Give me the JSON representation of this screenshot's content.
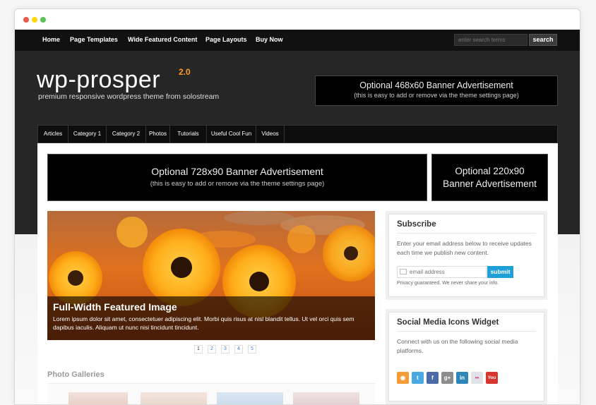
{
  "window_controls": {
    "close_color": "#ed594a",
    "minimize_color": "#fdd800",
    "zoom_color": "#5ac05a"
  },
  "top_nav": {
    "items": [
      "Home",
      "Page Templates",
      "Wide Featured Content",
      "Page Layouts",
      "Buy Now"
    ],
    "search_placeholder": "enter search terms",
    "search_button": "search"
  },
  "header": {
    "logo": "wp-prosper",
    "version": "2.0",
    "tagline": "premium responsive wordpress theme from solostream",
    "banner_468": {
      "line1": "Optional 468x60 Banner Advertisement",
      "line2": "(this is easy to add or remove via the theme settings page)"
    }
  },
  "category_nav": {
    "items": [
      "Articles",
      "Category 1",
      "Category 2",
      "Photos",
      "Tutorials",
      "Useful Cool Fun",
      "Videos"
    ]
  },
  "banners": {
    "banner_728": {
      "line1": "Optional 728x90 Banner Advertisement",
      "line2": "(this is easy to add or remove via the theme settings page)"
    },
    "banner_220": {
      "line1": "Optional 220x90",
      "line2": "Banner Advertisement"
    }
  },
  "featured": {
    "title": "Full-Width Featured Image",
    "text": "Lorem ipsum dolor sit amet, consectetuer adipiscing elit. Morbi quis risus at nisl blandit tellus. Ut vel orci quis sem dapibus iaculis. Aliquam ut nunc nisi tincidunt tincidunt.",
    "pages": [
      "1",
      "2",
      "3",
      "4",
      "5"
    ]
  },
  "photo_galleries": {
    "title": "Photo Galleries"
  },
  "subscribe": {
    "title": "Subscribe",
    "text": "Enter your email address below to receive updates each time we publish new content.",
    "email_placeholder": "email address",
    "submit": "submit",
    "privacy": "Privacy guaranteed. We never share your info."
  },
  "social": {
    "title": "Social Media Icons Widget",
    "text": "Connect with us on the following social media platforms.",
    "icons": [
      {
        "name": "rss-icon",
        "glyph": "◉",
        "color": "#f39b37"
      },
      {
        "name": "twitter-icon",
        "glyph": "t",
        "color": "#4ba9e1"
      },
      {
        "name": "facebook-icon",
        "glyph": "f",
        "color": "#4d6aa8"
      },
      {
        "name": "googleplus-icon",
        "glyph": "g+",
        "color": "#8c8c8c"
      },
      {
        "name": "linkedin-icon",
        "glyph": "in",
        "color": "#2f86b8"
      },
      {
        "name": "flickr-icon",
        "glyph": "••",
        "color": "#dfe3e8"
      },
      {
        "name": "youtube-icon",
        "glyph": "You",
        "color": "#d9352f"
      }
    ]
  }
}
